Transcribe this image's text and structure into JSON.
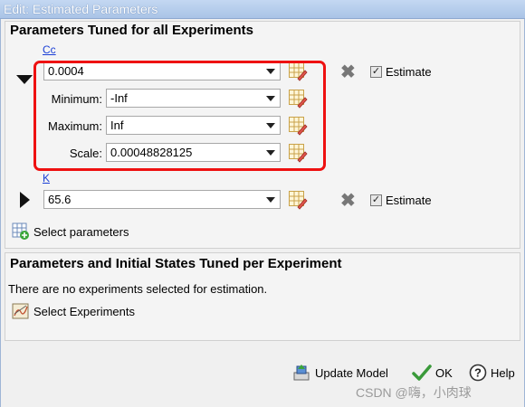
{
  "window": {
    "title": "Edit: Estimated Parameters"
  },
  "tuned_all": {
    "title": "Parameters Tuned for all Experiments",
    "params": [
      {
        "name": "Cc",
        "value": "0.0004",
        "expanded": true,
        "minimum_label": "Minimum:",
        "minimum": "-Inf",
        "maximum_label": "Maximum:",
        "maximum": "Inf",
        "scale_label": "Scale:",
        "scale": "0.00048828125",
        "estimate_label": "Estimate",
        "estimate_checked": true
      },
      {
        "name": "K",
        "value": "65.6",
        "expanded": false,
        "estimate_label": "Estimate",
        "estimate_checked": true
      }
    ],
    "select_params_label": "Select parameters"
  },
  "per_experiment": {
    "title": "Parameters and Initial States Tuned per Experiment",
    "message": "There are no experiments selected for estimation.",
    "select_experiments_label": "Select Experiments"
  },
  "footer": {
    "update_model_label": "Update Model",
    "ok_label": "OK",
    "help_label": "Help"
  },
  "watermark": "CSDN @嗨，小肉球",
  "colors": {
    "highlight_border": "#ee1111",
    "link": "#1a3fd6"
  }
}
